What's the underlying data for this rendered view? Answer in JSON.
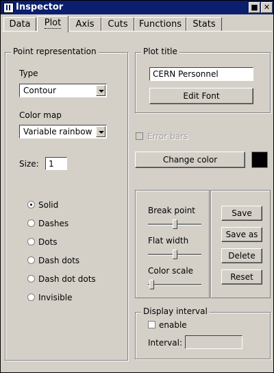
{
  "window": {
    "title": "Inspector",
    "minimize_icon": "restore-icon",
    "close_label": "✕"
  },
  "tabs": [
    {
      "label": "Data"
    },
    {
      "label": "Plot"
    },
    {
      "label": "Axis"
    },
    {
      "label": "Cuts"
    },
    {
      "label": "Functions"
    },
    {
      "label": "Stats"
    }
  ],
  "point_rep": {
    "legend": "Point representation",
    "type_label": "Type",
    "type_value": "Contour",
    "colormap_label": "Color map",
    "colormap_value": "Variable rainbow",
    "size_label": "Size:",
    "size_value": "1",
    "styles": [
      {
        "label": "Solid",
        "selected": true
      },
      {
        "label": "Dashes",
        "selected": false
      },
      {
        "label": "Dots",
        "selected": false
      },
      {
        "label": "Dash dots",
        "selected": false
      },
      {
        "label": "Dash dot dots",
        "selected": false
      },
      {
        "label": "Invisible",
        "selected": false
      }
    ]
  },
  "plot_title": {
    "legend": "Plot title",
    "value": "CERN Personnel",
    "edit_font": "Edit Font"
  },
  "error_bars": {
    "label": "Error bars",
    "checked": false,
    "enabled": false
  },
  "change_color": {
    "label": "Change color",
    "color": "#000000"
  },
  "sliders": {
    "break_point": {
      "label": "Break point",
      "level": 0.5
    },
    "flat_width": {
      "label": "Flat width",
      "level": 0.5
    },
    "color_scale": {
      "label": "Color scale",
      "level": 0.0
    }
  },
  "actions": {
    "save": "Save",
    "save_as": "Save as",
    "delete": "Delete",
    "reset": "Reset"
  },
  "display_interval": {
    "legend": "Display interval",
    "enable_label": "enable",
    "enabled": false,
    "interval_label": "Interval:",
    "interval_value": ""
  }
}
